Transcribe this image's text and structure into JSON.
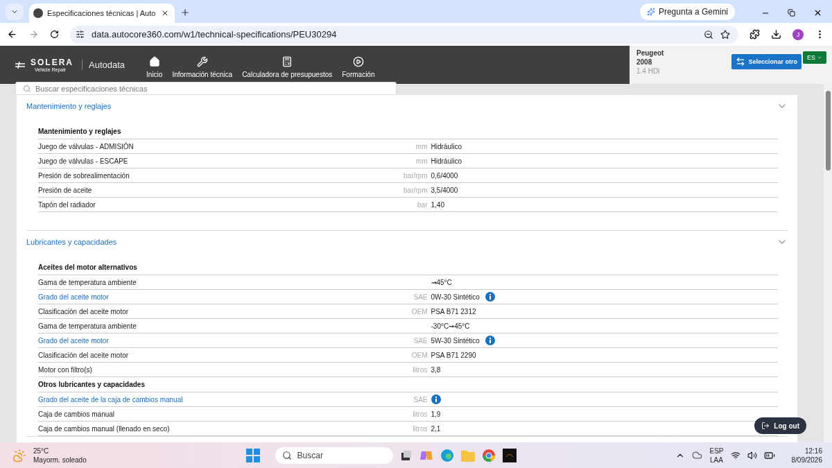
{
  "browser": {
    "tab_title": "Especificaciones técnicas | Auto",
    "url": "data.autocore360.com/w1/technical-specifications/PEU30294",
    "gemini": "Pregunta a Gemini",
    "avatar": "J"
  },
  "header": {
    "brand": "SOLERA",
    "brand_sub": "Vehicle Repair",
    "product": "Autodata",
    "nav": [
      {
        "kind": "home",
        "label": "Inicio"
      },
      {
        "kind": "wrench",
        "label": "Información técnica"
      },
      {
        "kind": "calculator",
        "label": "Calculadora de presupuestos"
      },
      {
        "kind": "play",
        "label": "Formación"
      }
    ],
    "vehicle": {
      "make": "Peugeot",
      "model": "2008",
      "engine": "1.4 HDi"
    },
    "select_button": "Seleccionar otro",
    "language": "ES"
  },
  "search": {
    "placeholder": "Buscar especificaciones técnicas"
  },
  "sections": [
    {
      "title": "Mantenimiento y reglajes",
      "expanded": true,
      "groups": [
        {
          "heading": "Mantenimiento y reglajes",
          "rows": [
            {
              "label": "Juego de válvulas - ADMISIÓN",
              "link": false,
              "unit": "mm",
              "value": "Hidráulico",
              "info": false
            },
            {
              "label": "Juego de válvulas - ESCAPE",
              "link": false,
              "unit": "mm",
              "value": "Hidráulico",
              "info": false
            },
            {
              "label": "Presión de sobrealimentación",
              "link": false,
              "unit": "bar/rpm",
              "value": "0,6/4000",
              "info": false
            },
            {
              "label": "Presión de aceite",
              "link": false,
              "unit": "bar/rpm",
              "value": "3,5/4000",
              "info": false
            },
            {
              "label": "Tapón del radiador",
              "link": false,
              "unit": "bar",
              "value": "1,40",
              "info": false
            }
          ]
        }
      ]
    },
    {
      "title": "Lubricantes y capacidades",
      "expanded": true,
      "groups": [
        {
          "heading": "Aceites del motor alternativos",
          "rows": [
            {
              "label": "Gama de temperatura ambiente",
              "link": false,
              "value": "➞45°C",
              "info": false
            },
            {
              "label": "Grado del aceite motor",
              "link": true,
              "unit": "SAE",
              "value": "0W-30 Sintético",
              "info": true
            },
            {
              "label": "Clasificación del aceite motor",
              "link": false,
              "unit": "OEM",
              "value": "PSA B71 2312",
              "info": false
            },
            {
              "label": "Gama de temperatura ambiente",
              "link": false,
              "value": "-30°C➞45°C",
              "info": false
            },
            {
              "label": "Grado del aceite motor",
              "link": true,
              "unit": "SAE",
              "value": "5W-30 Sintético",
              "info": true
            },
            {
              "label": "Clasificación del aceite motor",
              "link": false,
              "unit": "OEM",
              "value": "PSA B71 2290",
              "info": false
            },
            {
              "label": "Motor con filtro(s)",
              "link": false,
              "unit": "litros",
              "value": "3,8",
              "info": false
            }
          ]
        },
        {
          "heading": "Otros lubricantes y capacidades",
          "rows": [
            {
              "label": "Grado del aceite de la caja de cambios manual",
              "link": true,
              "unit": "SAE",
              "info": true
            },
            {
              "label": "Caja de cambios manual",
              "link": false,
              "unit": "litros",
              "value": "1,9",
              "info": false
            },
            {
              "label": "Caja de cambios manual (llenado en seco)",
              "link": false,
              "unit": "litros",
              "value": "2,1",
              "info": false
            }
          ]
        }
      ]
    }
  ],
  "logout": "Log out",
  "taskbar": {
    "temperature": "25°C",
    "weather": "Mayorm. soleado",
    "search": "Buscar",
    "lang": "ESP",
    "layout": "LAA",
    "time": "12:16",
    "date": "8/09/2026"
  }
}
